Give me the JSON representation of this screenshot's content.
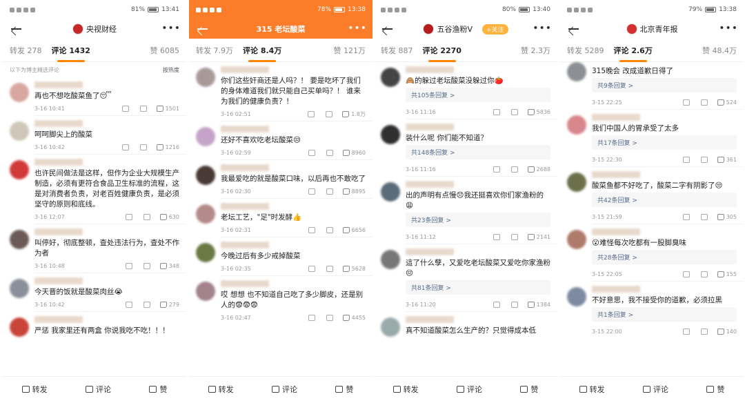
{
  "panels": [
    {
      "status": {
        "time": "13:41",
        "battery": "81%"
      },
      "account": {
        "name": "央视财经",
        "follow": ""
      },
      "tabs": {
        "forward": "转发 278",
        "comment": "评论 1432",
        "like": "赞 6085"
      },
      "subhead": {
        "left": "以下为博主精选评论",
        "right": "按热度"
      },
      "comments": [
        {
          "text": "再也不想吃酸菜鱼了😴",
          "time": "3-16 10:41",
          "likes": "1501",
          "reply": ""
        },
        {
          "text": "呵呵脚尖上的酸菜",
          "time": "3-16 10:42",
          "likes": "1216",
          "reply": ""
        },
        {
          "text": "也许民间做法是这样，但作为企业大规模生产制造，必须有更符合食品卫生标准的流程，这是对消费者负责，对老百姓健康负责，是必须坚守的原则和底线。",
          "time": "3-16 12:07",
          "likes": "630",
          "reply": ""
        },
        {
          "text": "叫停好，彻底整顿，查处违法行为，查处不作为者",
          "time": "3-16 10:48",
          "likes": "348",
          "reply": ""
        },
        {
          "text": "今天晋的饭就是酸菜肉丝😭",
          "time": "3-16 10:42",
          "likes": "279",
          "reply": ""
        },
        {
          "text": "严惩 我家里还有两盒 你说我吃不吃！！！",
          "time": "",
          "likes": "",
          "reply": ""
        }
      ],
      "bottom": {
        "forward": "转发",
        "comment": "评论",
        "like": "赞"
      }
    },
    {
      "status": {
        "time": "13:38",
        "battery": "78%"
      },
      "account": {
        "name": "315 老坛酸菜",
        "follow": ""
      },
      "tabs": {
        "forward": "转发 7.9万",
        "comment": "评论 8.4万",
        "like": "赞 121万"
      },
      "comments": [
        {
          "text": "你们这些奸商还是人吗？！ 要是吃坏了我们的身体难道我们就只能自己买单吗？！ 谁来为我们的健康负责？！",
          "time": "3-16 02:51",
          "likes": "1.8万",
          "reply": ""
        },
        {
          "text": "还好不喜欢吃老坛酸菜😒",
          "time": "3-16 02:59",
          "likes": "8960",
          "reply": ""
        },
        {
          "text": "我最爱吃的就是酸菜口味，以后再也不敢吃了",
          "time": "3-16 02:30",
          "likes": "8895",
          "reply": ""
        },
        {
          "text": "老坛工艺，\"足\"时发酵👍",
          "time": "3-16 02:31",
          "likes": "6656",
          "reply": ""
        },
        {
          "text": "今晚过后有多少戒掉酸菜",
          "time": "3-16 02:35",
          "likes": "5628",
          "reply": ""
        },
        {
          "text": "哎 想想 也不知道自己吃了多少脚皮，还是别人的😨😨😨",
          "time": "3-16 02:47",
          "likes": "4455",
          "reply": ""
        }
      ],
      "bottom": {
        "forward": "转发",
        "comment": "评论",
        "like": "赞"
      }
    },
    {
      "status": {
        "time": "13:40",
        "battery": "80%"
      },
      "account": {
        "name": "五谷渔粉V",
        "follow": "+关注"
      },
      "tabs": {
        "forward": "转发 887",
        "comment": "评论 2270",
        "like": "赞 2.3万"
      },
      "comments": [
        {
          "text": "🙈的躲过老坛酸菜没躲过你🍅",
          "time": "3-16 11:16",
          "likes": "5836",
          "reply": "共105条回复 >"
        },
        {
          "text": "装什么呢 你们能不知道？",
          "time": "3-16 11:16",
          "likes": "2688",
          "reply": "共148条回复 >"
        },
        {
          "text": "出的声明有点慢😞我还挺喜欢你们家渔粉的😩",
          "time": "3-16 11:12",
          "likes": "2141",
          "reply": "共23条回复 >"
        },
        {
          "text": "這了什么孽，又爱吃老坛酸菜又爱吃你家渔粉😔",
          "time": "3-16 11:20",
          "likes": "1384",
          "reply": "共81条回复 >"
        },
        {
          "text": "真不知道酸菜怎么生产的？只觉得成本低",
          "time": "",
          "likes": "",
          "reply": ""
        }
      ],
      "bottom": {
        "forward": "转发",
        "comment": "评论",
        "like": "赞"
      }
    },
    {
      "status": {
        "time": "13:38",
        "battery": "79%"
      },
      "account": {
        "name": "北京青年报",
        "follow": ""
      },
      "tabs": {
        "forward": "转发 5289",
        "comment": "评论 2.6万",
        "like": "赞 48.4万"
      },
      "comments": [
        {
          "text": "315晚会 改成道歉日得了",
          "time": "3-15 22:25",
          "likes": "524",
          "reply": "共9条回复 >"
        },
        {
          "text": "我们中国人的胃承受了太多",
          "time": "3-15 22:30",
          "likes": "361",
          "reply": "共17条回复 >"
        },
        {
          "text": "酸菜鱼都不好吃了，酸菜二字有阴影了😒",
          "time": "3-15 21:59",
          "likes": "305",
          "reply": "共42条回复 >"
        },
        {
          "text": "😮难怪每次吃都有一股脚臭味",
          "time": "3-15 22:05",
          "likes": "155",
          "reply": "共28条回复 >"
        },
        {
          "text": "不好意思，我不接受你的道歉，必须拉黑",
          "time": "3-15 22:00",
          "likes": "140",
          "reply": "共1条回复 >"
        }
      ],
      "bottom": {
        "forward": "转发",
        "comment": "评论",
        "like": "赞"
      }
    }
  ]
}
